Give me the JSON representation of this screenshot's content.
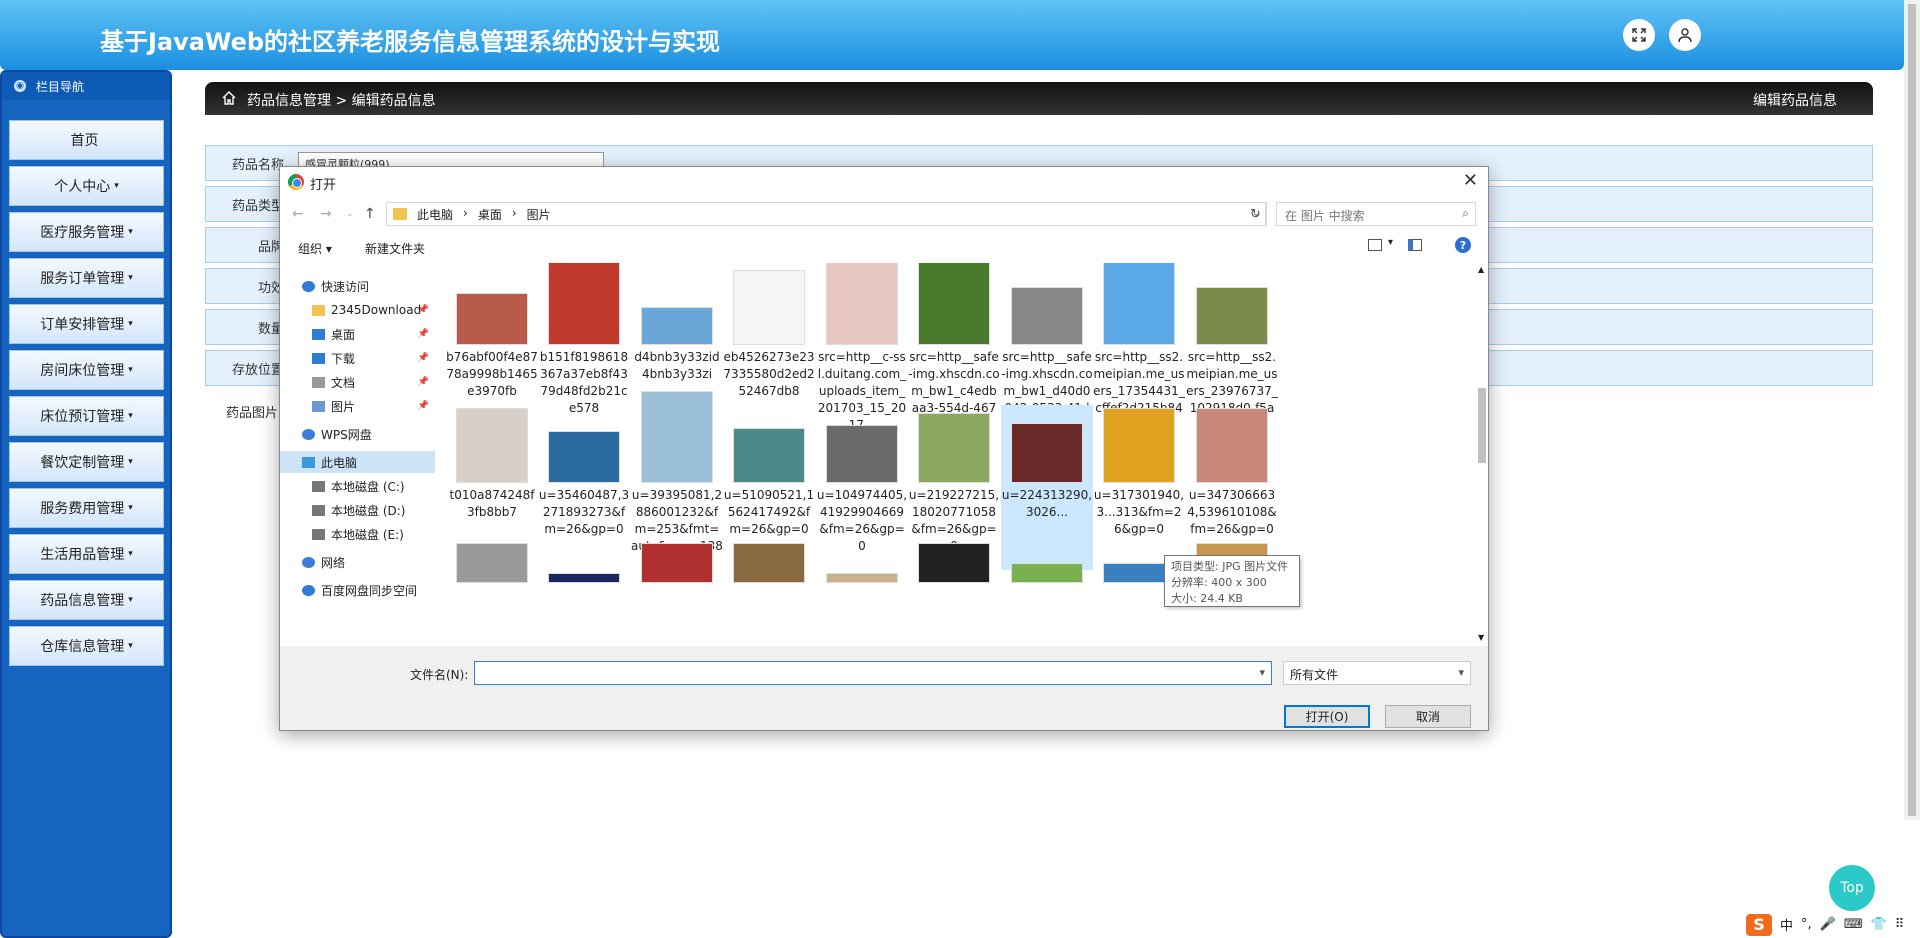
{
  "app": {
    "title": "基于JavaWeb的社区养老服务信息管理系统的设计与实现"
  },
  "topbar": {
    "icons": [
      "fullscreen-icon",
      "user-icon"
    ]
  },
  "sidebar": {
    "header": "栏目导航",
    "items": [
      {
        "label": "首页",
        "caret": ""
      },
      {
        "label": "个人中心",
        "caret": "▾"
      },
      {
        "label": "医疗服务管理",
        "caret": "▾"
      },
      {
        "label": "服务订单管理",
        "caret": "▾"
      },
      {
        "label": "订单安排管理",
        "caret": "▾"
      },
      {
        "label": "房间床位管理",
        "caret": "▾"
      },
      {
        "label": "床位预订管理",
        "caret": "▾"
      },
      {
        "label": "餐饮定制管理",
        "caret": "▾"
      },
      {
        "label": "服务费用管理",
        "caret": "▾"
      },
      {
        "label": "生活用品管理",
        "caret": "▾"
      },
      {
        "label": "药品信息管理",
        "caret": "▾"
      },
      {
        "label": "仓库信息管理",
        "caret": "▾"
      }
    ]
  },
  "breadcrumb": {
    "path": "药品信息管理 > 编辑药品信息",
    "right": "编辑药品信息"
  },
  "form": {
    "rows": [
      {
        "label": "药品名称",
        "value": "感冒灵颗粒(999)"
      },
      {
        "label": "药品类型",
        "value": ""
      },
      {
        "label": "品牌",
        "value": ""
      },
      {
        "label": "功效",
        "value": ""
      },
      {
        "label": "数量",
        "value": ""
      },
      {
        "label": "存放位置",
        "value": ""
      }
    ],
    "image_label": "药品图片"
  },
  "dialog": {
    "title": "打开",
    "close": "✕",
    "address": [
      "此电脑",
      "›",
      "桌面",
      "›",
      "图片"
    ],
    "search_placeholder": "在 图片 中搜索",
    "organize": "组织 ▾",
    "new_folder": "新建文件夹",
    "help": "?",
    "nav": [
      {
        "label": "快速访问",
        "icon": "star-icon",
        "pin": ""
      },
      {
        "label": "2345Download",
        "icon": "folder-icon",
        "pin": "📌"
      },
      {
        "label": "桌面",
        "icon": "desktop-icon",
        "pin": "📌"
      },
      {
        "label": "下载",
        "icon": "download-icon",
        "pin": "📌"
      },
      {
        "label": "文档",
        "icon": "document-icon",
        "pin": "📌"
      },
      {
        "label": "图片",
        "icon": "pictures-icon",
        "pin": "📌"
      },
      {
        "label": "WPS网盘",
        "icon": "cloud-icon",
        "pin": ""
      },
      {
        "label": "此电脑",
        "icon": "computer-icon",
        "pin": ""
      },
      {
        "label": "本地磁盘 (C:)",
        "icon": "drive-icon",
        "pin": ""
      },
      {
        "label": "本地磁盘 (D:)",
        "icon": "drive-icon",
        "pin": ""
      },
      {
        "label": "本地磁盘 (E:)",
        "icon": "drive-icon",
        "pin": ""
      },
      {
        "label": "网络",
        "icon": "network-icon",
        "pin": ""
      },
      {
        "label": "百度网盘同步空间",
        "icon": "baidu-icon",
        "pin": ""
      }
    ],
    "files": [
      {
        "name": "b76abf00f4e8778a9998b1465e3970fb",
        "color": "#b85a4a"
      },
      {
        "name": "b151f8198618367a37eb8f4379d48fd2b21ce578",
        "color": "#c0392b"
      },
      {
        "name": "d4bnb3y33zid4bnb3y33zi",
        "color": "#6aa6d8"
      },
      {
        "name": "eb4526273e237335580d2ed252467db8",
        "color": "#f5f5f5"
      },
      {
        "name": "src=http__c-ssl.duitang.com_uploads_item_201703_15_2017...",
        "color": "#e8c8c0"
      },
      {
        "name": "src=http__safe-img.xhscdn.com_bw1_c4edbaa3-554d-4677...",
        "color": "#4a7a2c"
      },
      {
        "name": "src=http__safe-img.xhscdn.com_bw1_d40d0042-0533-41d7...",
        "color": "#888888"
      },
      {
        "name": "src=http__ss2.meipian.me_users_17354431_cffef2d215b844...",
        "color": "#5aa8e6"
      },
      {
        "name": "src=http__ss2.meipian.me_users_23976737_102918d0-f5a1-...",
        "color": "#7a8a4a"
      },
      {
        "name": "t010a874248f3fb8bb7",
        "color": "#d8d0c8"
      },
      {
        "name": "u=35460487,3271893273&fm=26&gp=0",
        "color": "#2a6aa0"
      },
      {
        "name": "u=39395081,2886001232&fm=253&fmt=auto&app=138&f...",
        "color": "#9cc0d8"
      },
      {
        "name": "u=51090521,1562417492&fm=26&gp=0",
        "color": "#4a8a8a"
      },
      {
        "name": "u=104974405,41929904669&fm=26&gp=0",
        "color": "#6a6a6a"
      },
      {
        "name": "u=219227215,18020771058&fm=26&gp=0",
        "color": "#8aa860"
      },
      {
        "name": "u=224313290,3026...",
        "color": "#6a2a2a"
      },
      {
        "name": "u=317301940,3...313&fm=26&gp=0",
        "color": "#e0a020"
      },
      {
        "name": "u=3473066634,539610108&fm=26&gp=0",
        "color": "#c88878"
      },
      {
        "name": "",
        "color": "#9a9a9a"
      },
      {
        "name": "",
        "color": "#1a2a60"
      },
      {
        "name": "",
        "color": "#b03030"
      },
      {
        "name": "",
        "color": "#8a6a40"
      },
      {
        "name": "",
        "color": "#c8b090"
      },
      {
        "name": "",
        "color": "#222222"
      },
      {
        "name": "",
        "color": "#7ab050"
      },
      {
        "name": "",
        "color": "#3a80c0"
      },
      {
        "name": "",
        "color": "#c89850"
      }
    ],
    "tooltip": {
      "type": "项目类型: JPG 图片文件",
      "resolution": "分辨率: 400 x 300",
      "size": "大小: 24.4 KB"
    },
    "filename_label": "文件名(N):",
    "filename_value": "",
    "filetype": "所有文件",
    "open": "打开(O)",
    "cancel": "取消"
  },
  "top_button": "Top",
  "ime": {
    "logo": "S",
    "items": [
      "中",
      "°,",
      "🎤",
      "⌨",
      "👕",
      "⠿"
    ]
  }
}
